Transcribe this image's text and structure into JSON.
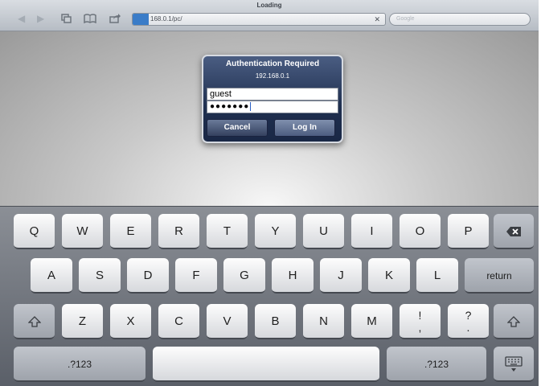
{
  "browser": {
    "page_title": "Loading",
    "url": "168.0.1/pc/",
    "search_placeholder": "Google",
    "icons": [
      "back-icon",
      "forward-icon",
      "tabs-icon",
      "bookmarks-icon",
      "share-icon",
      "stop-icon"
    ]
  },
  "dialog": {
    "title": "Authentication Required",
    "subtitle": "192.168.0.1",
    "username": "guest",
    "password_mask": "●●●●●●●",
    "cancel_label": "Cancel",
    "login_label": "Log In"
  },
  "keyboard": {
    "row1": [
      "Q",
      "W",
      "E",
      "R",
      "T",
      "Y",
      "U",
      "I",
      "O",
      "P"
    ],
    "row2": [
      "A",
      "S",
      "D",
      "F",
      "G",
      "H",
      "J",
      "K",
      "L"
    ],
    "row3": [
      "Z",
      "X",
      "C",
      "V",
      "B",
      "N",
      "M"
    ],
    "punct1_top": "!",
    "punct1_bottom": ",",
    "punct2_top": "?",
    "punct2_bottom": ".",
    "return_label": "return",
    "numbers_left": ".?123",
    "numbers_right": ".?123"
  }
}
